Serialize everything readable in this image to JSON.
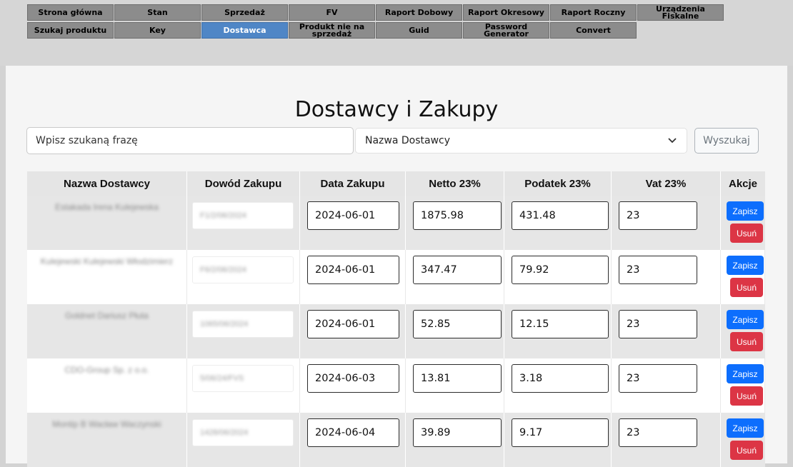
{
  "nav": {
    "row1": [
      "Strona główna",
      "Stan",
      "Sprzedaż",
      "FV",
      "Raport Dobowy",
      "Raport Okresowy",
      "Raport Roczny",
      "Urządzenia Fiskalne"
    ],
    "row2": [
      "Szukaj produktu",
      "Key",
      "Dostawca",
      "Produkt nie na sprzedaż",
      "Guid",
      "Password Generator",
      "Convert"
    ],
    "active": "Dostawca"
  },
  "page": {
    "title": "Dostawcy i Zakupy"
  },
  "search": {
    "placeholder": "Wpisz szukaną frazę",
    "select_value": "Nazwa Dostawcy",
    "button_label": "Wyszukaj"
  },
  "table": {
    "headers": [
      "Nazwa Dostawcy",
      "Dowód Zakupu",
      "Data Zakupu",
      "Netto 23%",
      "Podatek 23%",
      "Vat 23%",
      "Akcje"
    ],
    "rows": [
      {
        "supplier": "Estakada Irena Kulejewska",
        "proof": "F1/2/06/2024",
        "date": "2024-06-01",
        "netto": "1875.98",
        "tax": "431.48",
        "vat": "23"
      },
      {
        "supplier": "Kulejewski Kulejewski Włodzimierz",
        "proof": "F6/2/06/2024",
        "date": "2024-06-01",
        "netto": "347.47",
        "tax": "79.92",
        "vat": "23"
      },
      {
        "supplier": "Goldnet Dariusz Płuta",
        "proof": "1065/06/2024",
        "date": "2024-06-01",
        "netto": "52.85",
        "tax": "12.15",
        "vat": "23"
      },
      {
        "supplier": "CDO-Group Sp. z o.o.",
        "proof": "5/06/24/FVS",
        "date": "2024-06-03",
        "netto": "13.81",
        "tax": "3.18",
        "vat": "23"
      },
      {
        "supplier": "Montip B Wacław Waczynski",
        "proof": "1428/06/2024",
        "date": "2024-06-04",
        "netto": "39.89",
        "tax": "9.17",
        "vat": "23"
      }
    ],
    "actions": {
      "save": "Zapisz",
      "delete": "Usuń"
    }
  },
  "icons": {
    "select_chevron": "chevron-down-icon"
  },
  "colors": {
    "active_nav": "#4f86c6",
    "save_button": "#0d6efd",
    "delete_button": "#dc3545"
  }
}
